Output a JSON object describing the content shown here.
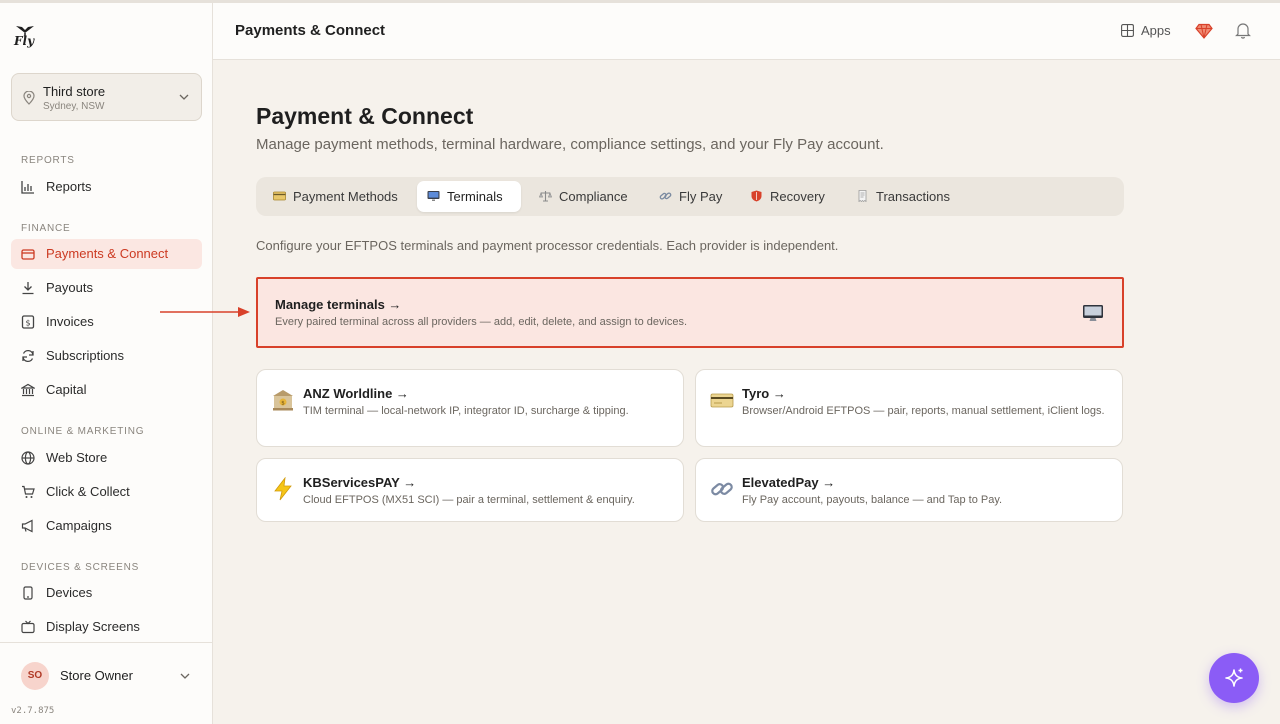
{
  "app": {
    "logo_text": "Fly",
    "version": "v2.7.875"
  },
  "store": {
    "name": "Third store",
    "location": "Sydney, NSW"
  },
  "sidebar": {
    "sections": [
      {
        "label": "REPORTS"
      },
      {
        "label": "FINANCE"
      },
      {
        "label": "ONLINE & MARKETING"
      },
      {
        "label": "DEVICES & SCREENS"
      }
    ],
    "items": [
      {
        "label": "Reports",
        "icon": "bar-chart-icon"
      },
      {
        "label": "Payments & Connect",
        "icon": "credit-card-icon",
        "active": true
      },
      {
        "label": "Payouts",
        "icon": "download-icon"
      },
      {
        "label": "Invoices",
        "icon": "dollar-doc-icon"
      },
      {
        "label": "Subscriptions",
        "icon": "refresh-icon"
      },
      {
        "label": "Capital",
        "icon": "bank-icon"
      },
      {
        "label": "Web Store",
        "icon": "globe-icon"
      },
      {
        "label": "Click & Collect",
        "icon": "cart-icon"
      },
      {
        "label": "Campaigns",
        "icon": "megaphone-icon"
      },
      {
        "label": "Devices",
        "icon": "phone-icon"
      },
      {
        "label": "Display Screens",
        "icon": "tv-icon"
      }
    ]
  },
  "user": {
    "initials": "SO",
    "name": "Store Owner"
  },
  "header": {
    "title": "Payments & Connect",
    "apps_label": "Apps"
  },
  "main": {
    "title": "Payment & Connect",
    "subtitle": "Manage payment methods, terminal hardware, compliance settings, and your Fly Pay account.",
    "tabs": [
      {
        "label": "Payment Methods",
        "icon": "card-emoji-icon"
      },
      {
        "label": "Terminals",
        "icon": "monitor-emoji-icon",
        "active": true
      },
      {
        "label": "Compliance",
        "icon": "scales-emoji-icon"
      },
      {
        "label": "Fly Pay",
        "icon": "link-emoji-icon"
      },
      {
        "label": "Recovery",
        "icon": "shield-emoji-icon"
      },
      {
        "label": "Transactions",
        "icon": "receipt-emoji-icon"
      }
    ],
    "intro": "Configure your EFTPOS terminals and payment processor credentials. Each provider is independent.",
    "manage": {
      "title": "Manage terminals →",
      "description": "Every paired terminal across all providers — add, edit, delete, and assign to devices."
    },
    "providers": [
      {
        "title": "ANZ Worldline →",
        "description": "TIM terminal — local-network IP, integrator ID, surcharge & tipping.",
        "icon": "bank-emoji-icon"
      },
      {
        "title": "Tyro →",
        "description": "Browser/Android EFTPOS — pair, reports, manual settlement, iClient logs.",
        "icon": "card-emoji-icon"
      },
      {
        "title": "KBServicesPAY →",
        "description": "Cloud EFTPOS (MX51 SCI) — pair a terminal, settlement & enquiry.",
        "icon": "lightning-emoji-icon"
      },
      {
        "title": "ElevatedPay →",
        "description": "Fly Pay account, payouts, balance — and Tap to Pay.",
        "icon": "link-emoji-icon"
      }
    ]
  },
  "colors": {
    "accent": "#cc3a22",
    "highlight_border": "#d8412a",
    "fab": "#8b5cf6"
  }
}
